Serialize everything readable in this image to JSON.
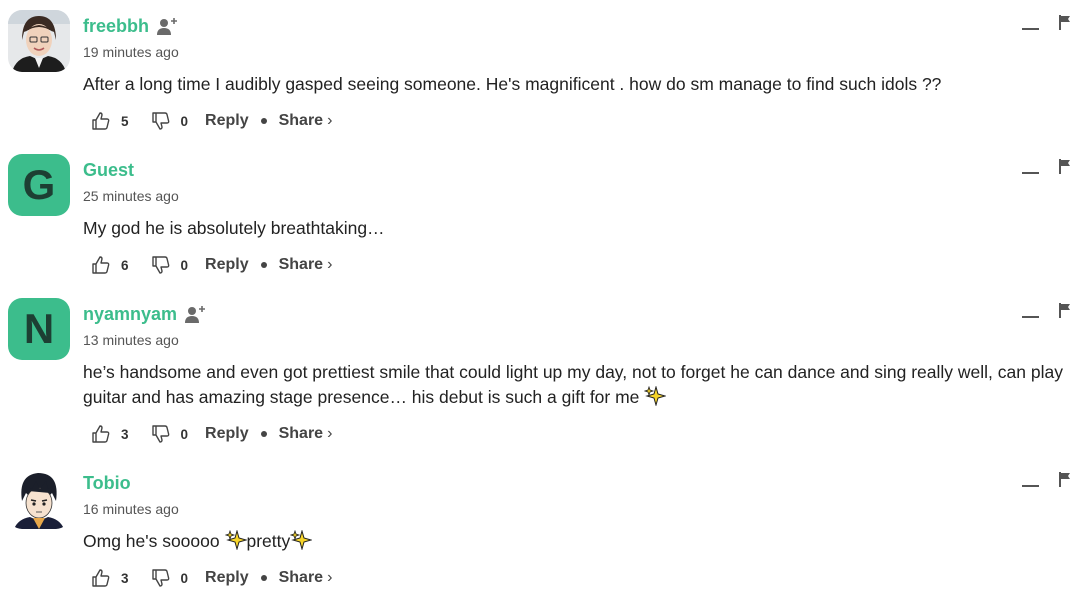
{
  "comments": [
    {
      "author": "freebbh",
      "time": "19 minutes ago",
      "text": "After a long time I audibly gasped seeing someone. He's magnificent . how do sm manage to find such idols ??",
      "likes": "5",
      "dislikes": "0",
      "reply_label": "Reply",
      "share_label": "Share",
      "share_chevron": "›",
      "avatar": "photo"
    },
    {
      "author": "Guest",
      "time": "25 minutes ago",
      "text": "My god he is absolutely breathtaking…",
      "likes": "6",
      "dislikes": "0",
      "reply_label": "Reply",
      "share_label": "Share",
      "share_chevron": "›",
      "avatar_letter": "G"
    },
    {
      "author": "nyamnyam",
      "time": "13 minutes ago",
      "text_line1": "he’s handsome and even got prettiest smile that could light up my day, not to forget he can dance and sing really well, can play",
      "text_line2": "guitar and has amazing stage presence… his debut is such a gift for me",
      "likes": "3",
      "dislikes": "0",
      "reply_label": "Reply",
      "share_label": "Share",
      "share_chevron": "›",
      "avatar_letter": "N"
    },
    {
      "author": "Tobio",
      "time": "16 minutes ago",
      "text_part1": "Omg he's sooooo",
      "text_part2": "pretty",
      "likes": "3",
      "dislikes": "0",
      "reply_label": "Reply",
      "share_label": "Share",
      "share_chevron": "›",
      "avatar": "anime-drawing"
    }
  ],
  "colors": {
    "accent": "#3cbd8c",
    "avatar_letter": "#1d3f33",
    "text": "#222222",
    "muted": "#555555"
  },
  "icons": {
    "follow": "add-user-icon",
    "like": "thumbs-up-icon",
    "dislike": "thumbs-down-icon",
    "minimize": "minimize-icon",
    "flag": "flag-icon",
    "emoji": "sparkles-emoji"
  }
}
